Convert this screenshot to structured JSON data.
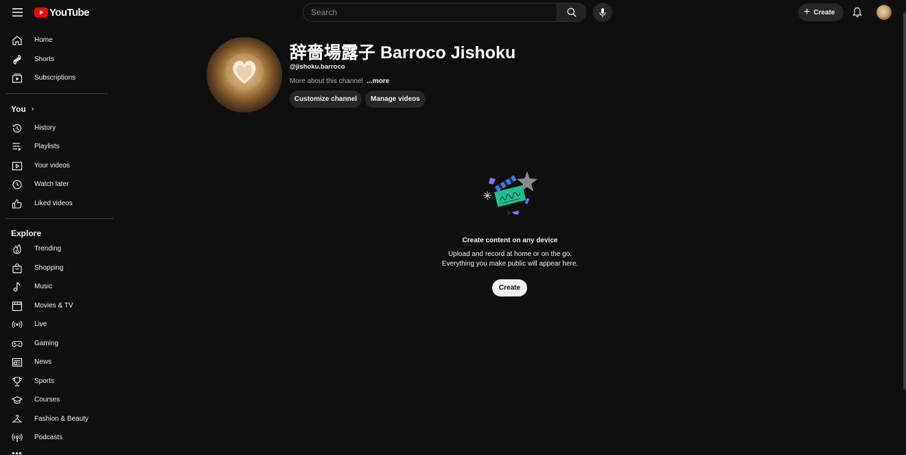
{
  "header": {
    "logo_text": "YouTube",
    "search_placeholder": "Search",
    "create_label": "Create"
  },
  "sidebar": {
    "main_items": [
      {
        "label": "Home",
        "icon": "home-icon"
      },
      {
        "label": "Shorts",
        "icon": "shorts-icon"
      },
      {
        "label": "Subscriptions",
        "icon": "subscriptions-icon"
      }
    ],
    "you_title": "You",
    "you_items": [
      {
        "label": "History",
        "icon": "history-icon"
      },
      {
        "label": "Playlists",
        "icon": "playlists-icon"
      },
      {
        "label": "Your videos",
        "icon": "your-videos-icon"
      },
      {
        "label": "Watch later",
        "icon": "watch-later-icon"
      },
      {
        "label": "Liked videos",
        "icon": "liked-videos-icon"
      }
    ],
    "explore_title": "Explore",
    "explore_items": [
      {
        "label": "Trending",
        "icon": "trending-icon"
      },
      {
        "label": "Shopping",
        "icon": "shopping-icon"
      },
      {
        "label": "Music",
        "icon": "music-icon"
      },
      {
        "label": "Movies & TV",
        "icon": "movies-icon"
      },
      {
        "label": "Live",
        "icon": "live-icon"
      },
      {
        "label": "Gaming",
        "icon": "gaming-icon"
      },
      {
        "label": "News",
        "icon": "news-icon"
      },
      {
        "label": "Sports",
        "icon": "sports-icon"
      },
      {
        "label": "Courses",
        "icon": "courses-icon"
      },
      {
        "label": "Fashion & Beauty",
        "icon": "fashion-icon"
      },
      {
        "label": "Podcasts",
        "icon": "podcasts-icon"
      }
    ]
  },
  "channel": {
    "name": "辞嗇場露子 Barroco Jishoku",
    "handle": "@jishoku.barroco",
    "about": "More about this channel",
    "more": "...more",
    "customize_label": "Customize channel",
    "manage_label": "Manage videos"
  },
  "empty_state": {
    "title": "Create content on any device",
    "line1": "Upload and record at home or on the go.",
    "line2": "Everything you make public will appear here.",
    "create_label": "Create"
  },
  "colors": {
    "background": "#0f0f0f",
    "brand_red": "#ff0000",
    "pill_bg": "#272727",
    "accent_green": "#1fbf8f",
    "accent_purple": "#9c6bff",
    "accent_blue": "#3f7bff"
  }
}
